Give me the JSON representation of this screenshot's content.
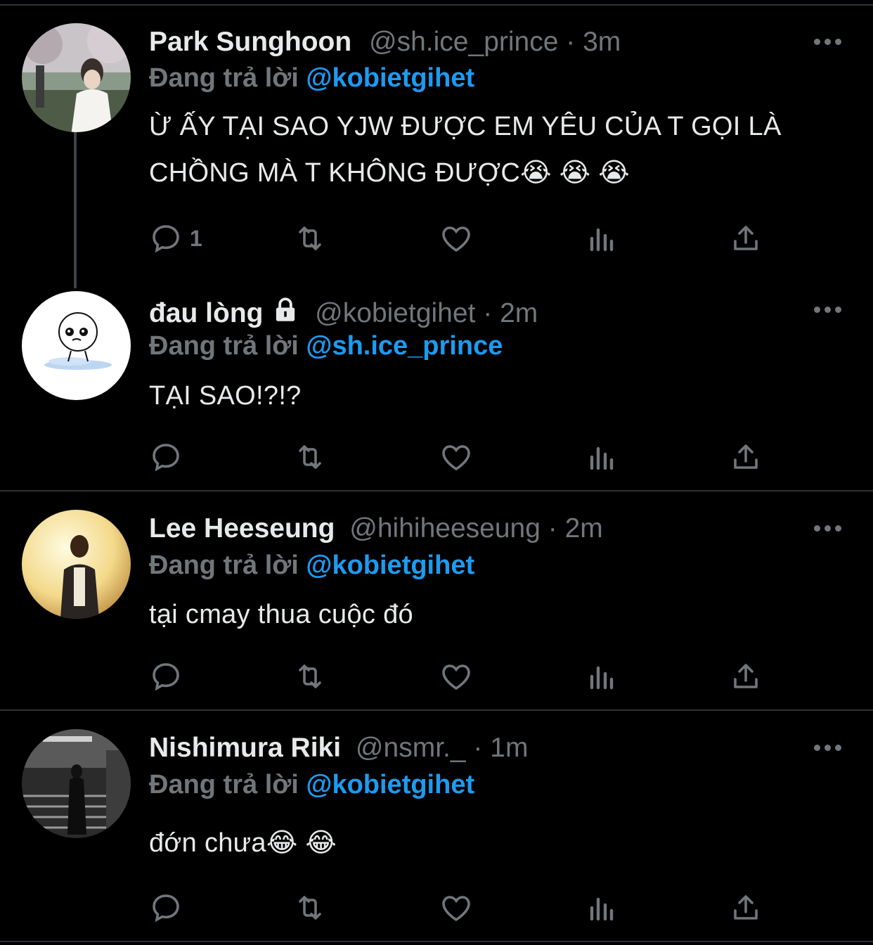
{
  "tweets": [
    {
      "name": "Park Sunghoon",
      "handle": "@sh.ice_prince",
      "dot": "·",
      "time": "3m",
      "reply_prefix": "Đang trả lời",
      "reply_to": "@kobietgihet",
      "text": "Ừ ẤY TẠI SAO YJW ĐƯỢC EM YÊU CỦA T GỌI LÀ CHỒNG MÀ T KHÔNG ĐƯỢC😭 😭 😭",
      "reply_count": "1"
    },
    {
      "name": "đau lòng",
      "handle": "@kobietgihet",
      "dot": "·",
      "time": "2m",
      "reply_prefix": "Đang trả lời",
      "reply_to": "@sh.ice_prince",
      "text": "TẠI SAO!?!?",
      "reply_count": ""
    },
    {
      "name": "Lee Heeseung",
      "handle": "@hihiheeseung",
      "dot": "·",
      "time": "2m",
      "reply_prefix": "Đang trả lời",
      "reply_to": "@kobietgihet",
      "text": "tại cmay thua cuộc đó",
      "reply_count": ""
    },
    {
      "name": "Nishimura Riki",
      "handle": "@nsmr._",
      "dot": "·",
      "time": "1m",
      "reply_prefix": "Đang trả lời",
      "reply_to": "@kobietgihet",
      "text": "đớn chưa😂 😂",
      "reply_count": ""
    }
  ],
  "icons": {
    "reply": "speech-bubble-icon",
    "retweet": "retweet-icon",
    "like": "heart-icon",
    "analytics": "bar-chart-icon",
    "share": "share-icon",
    "more": "more-dots-icon",
    "protected": "lock-icon"
  },
  "colors": {
    "background": "#000000",
    "text": "#e7e9ea",
    "secondary": "#71767b",
    "accent": "#1d9bf0",
    "divider": "#2f3336"
  }
}
